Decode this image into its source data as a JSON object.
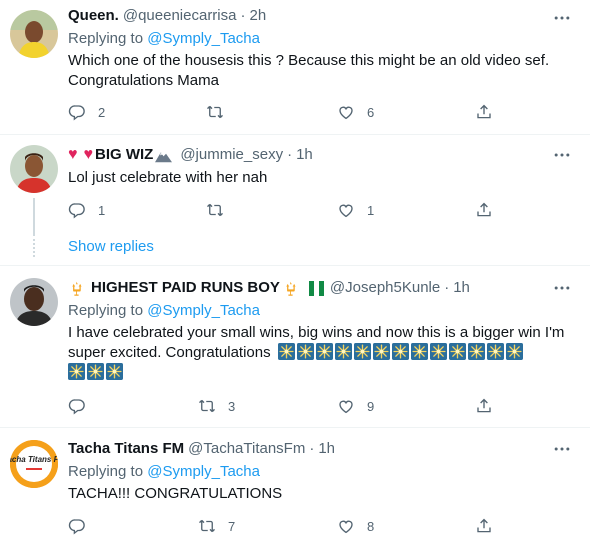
{
  "tweets": [
    {
      "name": "Queen.",
      "handle": "@queeniecarrisa",
      "time": "2h",
      "replying_label": "Replying to ",
      "replying_to": "@Symply_Tacha",
      "text_line1": "Which one of the housesis this ? Because this might be an old video sef.",
      "text_line2": "Congratulations Mama",
      "replies": "2",
      "retweets": "",
      "likes": "6"
    },
    {
      "name": "BIG WIZ",
      "handle": "@jummie_sexy",
      "time": "1h",
      "text": "Lol just celebrate with her nah",
      "replies": "1",
      "retweets": "",
      "likes": "1",
      "show_replies": "Show replies"
    },
    {
      "name": "HIGHEST PAID RUNS BOY",
      "handle": "@Joseph5Kunle",
      "time": "1h",
      "replying_label": "Replying to ",
      "replying_to": "@Symply_Tacha",
      "text_line1": "I have celebrated your small wins, big wins and now this is a bigger win I'm",
      "text_line2": "super excited. Congratulations",
      "replies": "",
      "retweets": "3",
      "likes": "9"
    },
    {
      "name": "Tacha Titans FM",
      "handle": "@TachaTitansFm",
      "time": "1h",
      "replying_label": "Replying to ",
      "replying_to": "@Symply_Tacha",
      "text": "TACHA!!! CONGRATULATIONS",
      "replies": "",
      "retweets": "7",
      "likes": "8",
      "avatar_text": "Tacha Titans FM"
    }
  ],
  "dot": "·",
  "colors": {
    "link": "#1d9bf0",
    "muted": "#536471",
    "text": "#0f1419"
  }
}
